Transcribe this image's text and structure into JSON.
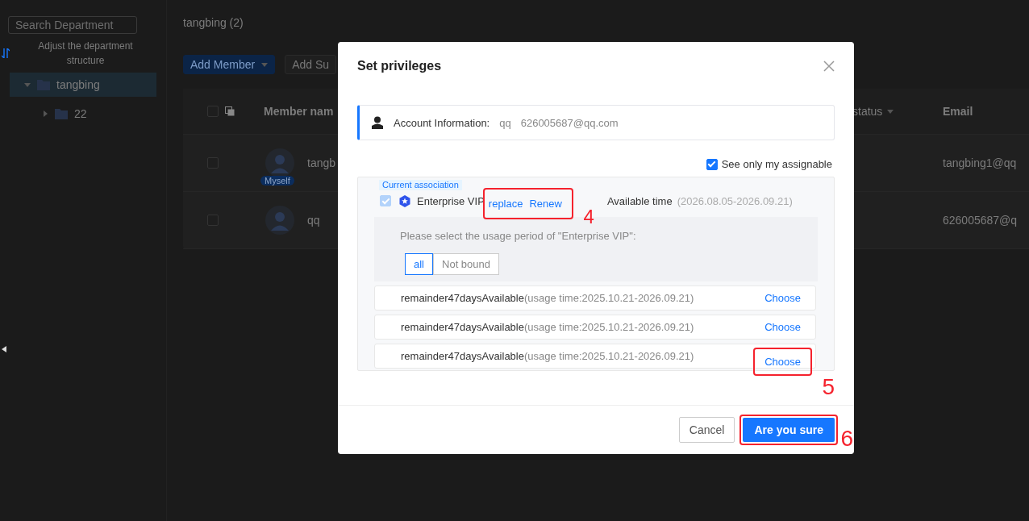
{
  "sidebar": {
    "search": {
      "placeholder": "Search Department"
    },
    "adjust_label": "Adjust the department structure",
    "tree": [
      {
        "label": "tangbing",
        "expanded": true,
        "selected": true,
        "children": [
          {
            "label": "22",
            "expanded": false,
            "selected": false
          }
        ]
      }
    ]
  },
  "main": {
    "title": "tangbing (2)",
    "buttons": [
      {
        "label": "Add Member",
        "kind": "dropdown"
      },
      {
        "label": "Add Su",
        "kind": "plain"
      }
    ],
    "table": {
      "select_all_checked": false,
      "columns": [
        "Member nam",
        "status",
        "Email"
      ],
      "rows": [
        {
          "name": "tangb",
          "badge": "Myself",
          "email": "tangbing1@qq",
          "checked": false
        },
        {
          "name": "qq",
          "email": "626005687@q",
          "checked": false
        }
      ]
    }
  },
  "dialog": {
    "title": "Set privileges",
    "account": {
      "label": "Account Information:",
      "name": "qq",
      "email": "626005687@qq.com"
    },
    "filter": {
      "label": "See only my assignable",
      "checked": true
    },
    "association": {
      "tag": "Current association",
      "checked": true,
      "disabled": true,
      "product": "Enterprise VIP",
      "actions": [
        "replace",
        "Renew"
      ],
      "actions_callout": "4",
      "available_label": "Available time",
      "available_range": "(2026.08.05-2026.09.21)",
      "period_prompt": "Please select the usage period of \"Enterprise VIP\":",
      "segments": [
        {
          "label": "all",
          "selected": true
        },
        {
          "label": "Not bound",
          "selected": false
        }
      ],
      "periods": [
        {
          "remainder": "remainder47daysAvailable",
          "usage": "(usage time:2025.10.21-2026.09.21)",
          "action": "Choose"
        },
        {
          "remainder": "remainder47daysAvailable",
          "usage": "(usage time:2025.10.21-2026.09.21)",
          "action": "Choose"
        },
        {
          "remainder": "remainder47daysAvailable",
          "usage": "(usage time:2025.10.21-2026.09.21)",
          "action": "Choose",
          "callout": "5"
        }
      ]
    },
    "footer": {
      "cancel": "Cancel",
      "confirm": "Are you sure",
      "confirm_callout": "6"
    }
  }
}
